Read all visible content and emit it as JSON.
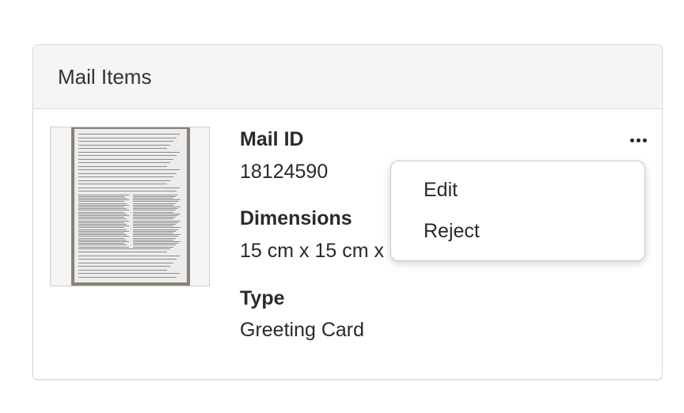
{
  "card": {
    "title": "Mail Items"
  },
  "mail_item": {
    "thumbnail_icon": "scanned-document-thumbnail",
    "fields": [
      {
        "label": "Mail ID",
        "value": "18124590"
      },
      {
        "label": "Dimensions",
        "value": "15 cm x 15 cm x"
      },
      {
        "label": "Type",
        "value": "Greeting Card"
      }
    ]
  },
  "more_menu": {
    "icon": "more-horizontal-icon",
    "items": [
      {
        "label": "Edit"
      },
      {
        "label": "Reject"
      }
    ]
  }
}
